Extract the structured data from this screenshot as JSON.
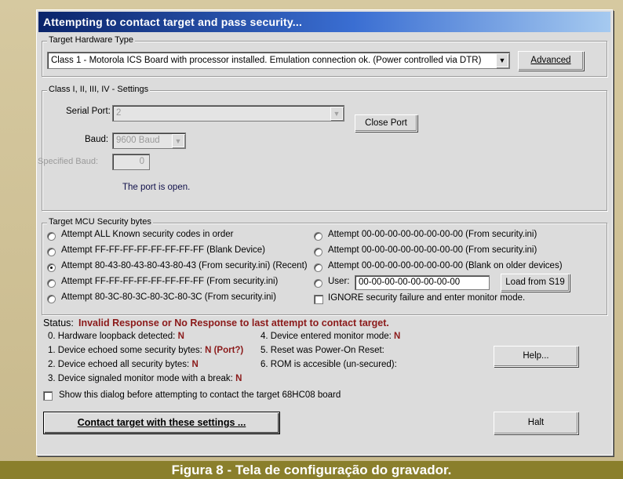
{
  "window": {
    "title": "Attempting to contact target and pass security..."
  },
  "hardware": {
    "group_label": "Target Hardware Type",
    "selected": "Class 1 - Motorola ICS Board with processor installed. Emulation connection ok. (Power controlled via DTR)",
    "advanced_button": "Advanced"
  },
  "settings": {
    "group_label": "Class I, II, III, IV - Settings",
    "serial_port_label": "Serial Port:",
    "serial_port_value": "2",
    "close_port_button": "Close Port",
    "baud_label": "Baud:",
    "baud_value": "9600 Baud",
    "specified_baud_label": "Specified Baud:",
    "specified_baud_value": "0",
    "port_status": "The port is open."
  },
  "security": {
    "group_label": "Target MCU Security bytes",
    "left_options": [
      "Attempt ALL Known security codes in order",
      "Attempt FF-FF-FF-FF-FF-FF-FF-FF (Blank Device)",
      "Attempt 80-43-80-43-80-43-80-43 (From security.ini) (Recent)",
      "Attempt FF-FF-FF-FF-FF-FF-FF-FF (From security.ini)",
      "Attempt 80-3C-80-3C-80-3C-80-3C (From security.ini)"
    ],
    "right_options": [
      "Attempt 00-00-00-00-00-00-00-00 (From security.ini)",
      "Attempt 00-00-00-00-00-00-00-00 (From security.ini)",
      "Attempt 00-00-00-00-00-00-00-00 (Blank on older devices)"
    ],
    "user_label": "User:",
    "user_value": "00-00-00-00-00-00-00-00",
    "load_button": "Load from S19",
    "ignore_label": "IGNORE security failure and enter monitor mode."
  },
  "status": {
    "label": "Status:",
    "message": "Invalid Response or No Response to last attempt to contact target.",
    "left": [
      {
        "text": "0. Hardware loopback detected:",
        "value": "N"
      },
      {
        "text": "1. Device echoed some security bytes:",
        "value": "N (Port?)"
      },
      {
        "text": "2. Device echoed all security bytes:",
        "value": "N"
      },
      {
        "text": "3. Device signaled monitor mode with a break:",
        "value": "N"
      }
    ],
    "right": [
      {
        "text": "4. Device entered monitor mode:",
        "value": "N"
      },
      {
        "text": "5. Reset was Power-On Reset:",
        "value": ""
      },
      {
        "text": "6. ROM is accesible (un-secured):",
        "value": ""
      }
    ]
  },
  "footer": {
    "help_button": "Help...",
    "show_dialog_label": "Show this dialog before attempting to contact the target 68HC08 board",
    "contact_button": "Contact target with these settings ...",
    "halt_button": "Halt"
  },
  "caption": "Figura 8 - Tela de configuração do gravador."
}
